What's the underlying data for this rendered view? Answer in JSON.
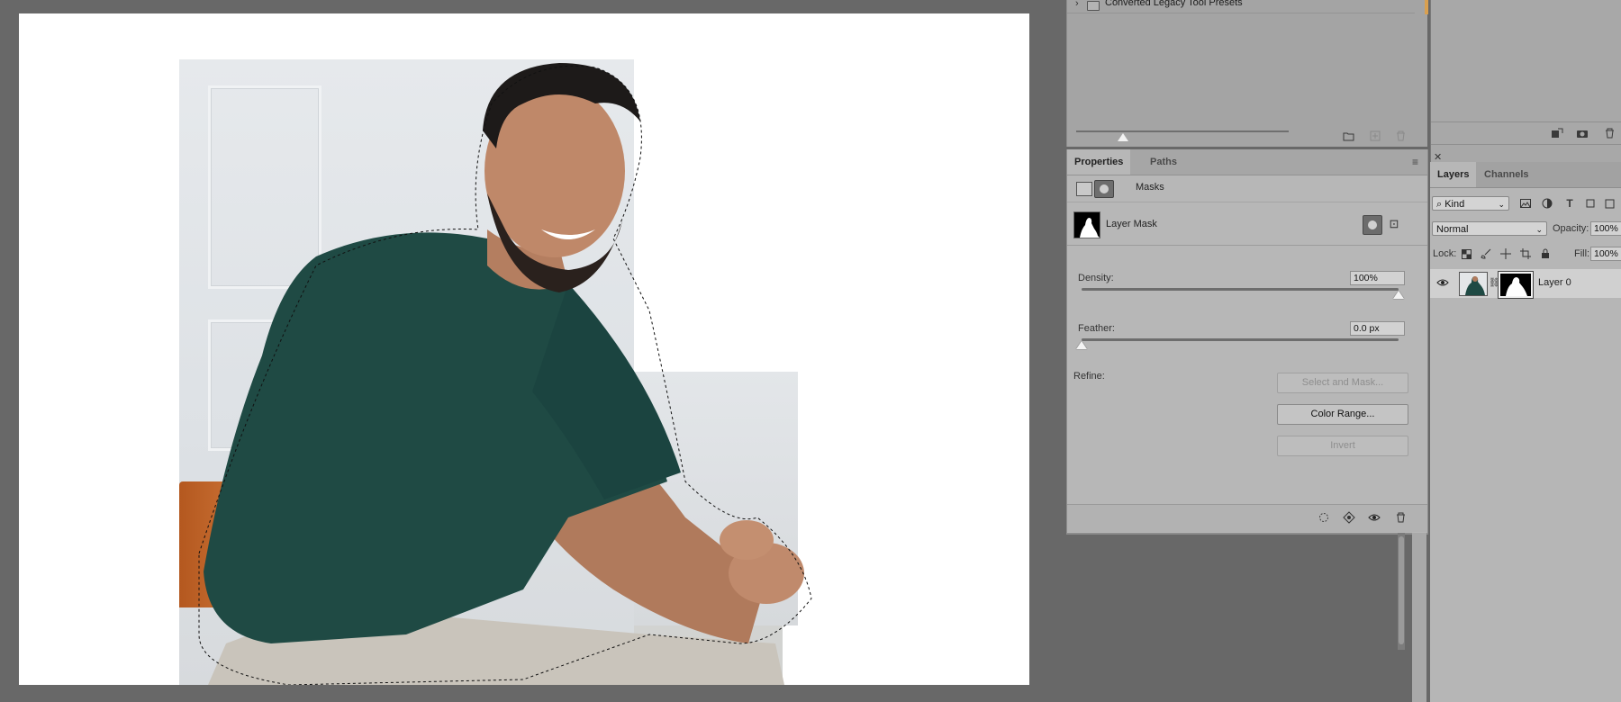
{
  "presets": {
    "folder_label": "Converted Legacy Tool Presets"
  },
  "properties": {
    "tabs": [
      "Properties",
      "Paths"
    ],
    "masks_label": "Masks",
    "layer_mask_label": "Layer Mask",
    "density_label": "Density:",
    "density_value": "100%",
    "feather_label": "Feather:",
    "feather_value": "0.0 px",
    "refine_label": "Refine:",
    "buttons": {
      "select_and_mask": "Select and Mask...",
      "color_range": "Color Range...",
      "invert": "Invert"
    }
  },
  "layers": {
    "tabs": [
      "Layers",
      "Channels"
    ],
    "kind_label": "Kind",
    "blend_mode": "Normal",
    "opacity_label": "Opacity:",
    "opacity_value": "100%",
    "lock_label": "Lock:",
    "fill_label": "Fill:",
    "fill_value": "100%",
    "layer_name": "Layer 0"
  },
  "colors": {
    "app_background": "#686868",
    "panel": "#b7b7b7",
    "shirt": "#1f4a44",
    "chair": "#c0662a"
  },
  "icons": {
    "close": "close-icon",
    "panel_menu": "hamburger-icon",
    "visibility": "eye-icon"
  }
}
